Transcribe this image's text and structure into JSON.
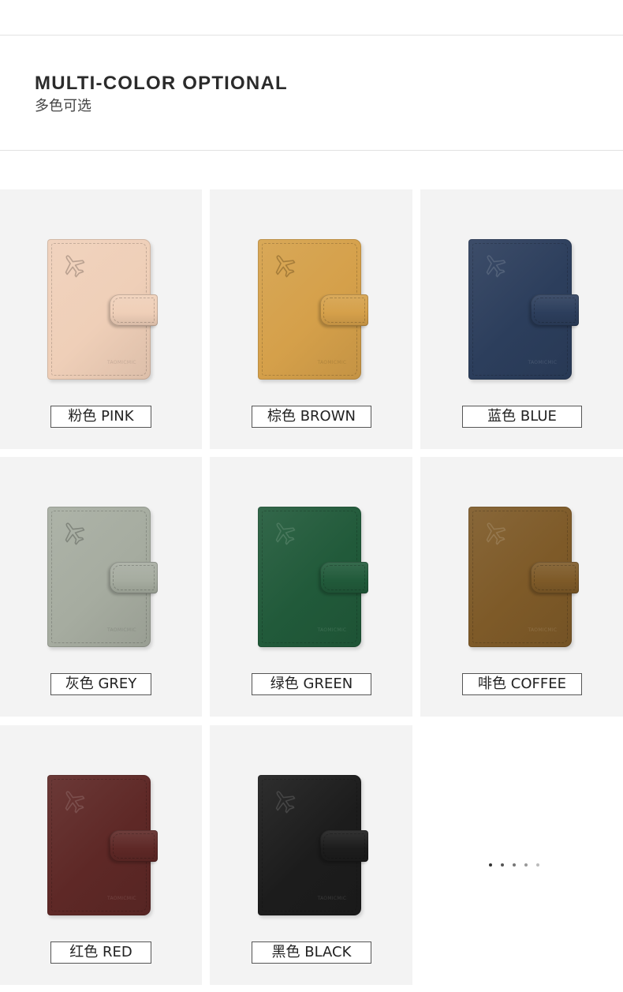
{
  "header": {
    "title": "MULTI-COLOR OPTIONAL",
    "subtitle": "多色可选"
  },
  "products": [
    {
      "label": "粉色 PINK",
      "color": "#efcfb8",
      "brand": "TAOMICMIC"
    },
    {
      "label": "棕色 BROWN",
      "color": "#d5a04a",
      "brand": "TAOMICMIC"
    },
    {
      "label": "蓝色 BLUE",
      "color": "#2c3e5c",
      "brand": "TAOMICMIC"
    },
    {
      "label": "灰色 GREY",
      "color": "#a6aca0",
      "brand": "TAOMICMIC"
    },
    {
      "label": "绿色 GREEN",
      "color": "#215a3a",
      "brand": "TAOMICMIC"
    },
    {
      "label": "啡色 COFFEE",
      "color": "#7e5a28",
      "brand": "TAOMICMIC"
    },
    {
      "label": "红色 RED",
      "color": "#5e2826",
      "brand": "TAOMICMIC"
    },
    {
      "label": "黑色 BLACK",
      "color": "#1c1c1c",
      "brand": "TAOMICMIC"
    }
  ],
  "pagination_dots": 5
}
